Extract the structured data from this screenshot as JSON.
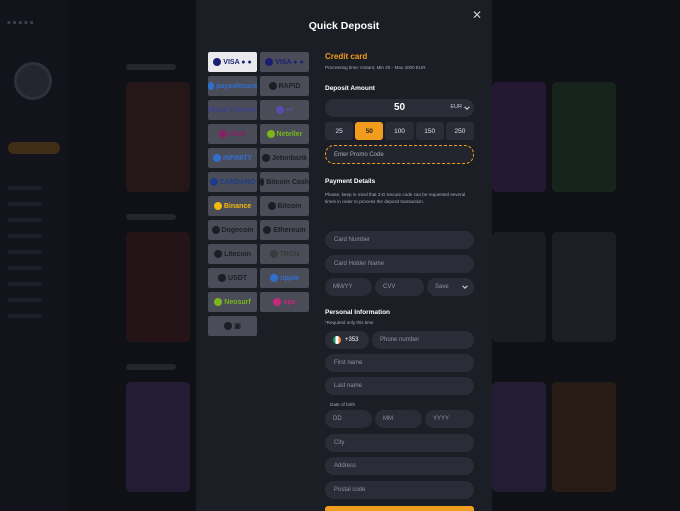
{
  "modal": {
    "title": "Quick Deposit",
    "close_icon": "close-icon"
  },
  "methods": [
    {
      "label": "VISA ● ●",
      "icon": "visa-mastercard-icon",
      "selected": true,
      "color": "#1a1f71"
    },
    {
      "label": "VISA ● ●",
      "icon": "visa-mastercard-icon",
      "selected": false,
      "color": "#1a1f71"
    },
    {
      "label": "paysafecard",
      "icon": "paysafecard-icon",
      "selected": false,
      "color": "#2f6fd0"
    },
    {
      "label": "RAPID",
      "icon": "rapid-transfer-icon",
      "selected": false,
      "color": "#1c1e26"
    },
    {
      "label": "Bank Transfer",
      "icon": "bank-transfer-icon",
      "selected": false,
      "color": "#3b3e8e"
    },
    {
      "label": "•••",
      "icon": "instant-banking-icon",
      "selected": false,
      "color": "#5a4bb0"
    },
    {
      "label": "Skrill",
      "icon": "skrill-icon",
      "selected": false,
      "color": "#862165"
    },
    {
      "label": "Neteller",
      "icon": "neteller-icon",
      "selected": false,
      "color": "#7ab51d"
    },
    {
      "label": "INFINITY",
      "icon": "infinity-icon",
      "selected": false,
      "color": "#2f6fd0"
    },
    {
      "label": "Jetonbank",
      "icon": "jetonbank-icon",
      "selected": false,
      "color": "#1c1e26"
    },
    {
      "label": "CARDANO",
      "icon": "cardano-icon",
      "selected": false,
      "color": "#1d3b8a"
    },
    {
      "label": "Bitcoin Cash",
      "icon": "bitcoin-cash-icon",
      "selected": false,
      "color": "#1c1e26"
    },
    {
      "label": "Binance",
      "icon": "binance-icon",
      "selected": false,
      "color": "#f0b90b"
    },
    {
      "label": "Bitcoin",
      "icon": "bitcoin-icon",
      "selected": false,
      "color": "#1c1e26"
    },
    {
      "label": "Dogecoin",
      "icon": "dogecoin-icon",
      "selected": false,
      "color": "#1c1e26"
    },
    {
      "label": "Ethereum",
      "icon": "ethereum-icon",
      "selected": false,
      "color": "#1c1e26"
    },
    {
      "label": "Litecoin",
      "icon": "litecoin-icon",
      "selected": false,
      "color": "#1c1e26"
    },
    {
      "label": "TRON",
      "icon": "tron-icon",
      "selected": false,
      "color": "#3a3a3a"
    },
    {
      "label": "USDT",
      "icon": "usdt-icon",
      "selected": false,
      "color": "#1c1e26"
    },
    {
      "label": "ripple",
      "icon": "ripple-icon",
      "selected": false,
      "color": "#2f6fd0"
    },
    {
      "label": "Neosurf",
      "icon": "neosurf-icon",
      "selected": false,
      "color": "#7ab51d"
    },
    {
      "label": "eps",
      "icon": "eps-icon",
      "selected": false,
      "color": "#c8287c"
    },
    {
      "label": "▣",
      "icon": "voucher-icon",
      "selected": false,
      "color": "#1c1e26"
    }
  ],
  "credit_card": {
    "title": "Credit card",
    "processing": "Processing time: Instant, Min 20 - Max 4000 EUR"
  },
  "deposit": {
    "title": "Deposit Amount",
    "amount": "50",
    "currency": "EUR",
    "chips": [
      "25",
      "50",
      "100",
      "150",
      "250"
    ],
    "active_chip": "50",
    "promo_placeholder": "Enter Promo Code"
  },
  "payment": {
    "title": "Payment Details",
    "note": "Please, keep in mind that 3-D Secure code can be requested several times in order to process the deposit transaction.",
    "card_number": "Card Number",
    "holder": "Card Holder Name",
    "mmyy": "MM/YY",
    "cvv": "CVV",
    "save": "Save"
  },
  "personal": {
    "title": "Personal Information",
    "required_note": "*Required only this time",
    "country_code": "+353",
    "phone": "Phone number",
    "first_name": "First name",
    "last_name": "Last name",
    "dob_label": "Date of birth",
    "dd": "DD",
    "mm": "MM",
    "yyyy": "YYYY",
    "city": "City",
    "address": "Address",
    "postal": "Postal code"
  },
  "colors": {
    "accent": "#f19c1c",
    "modal_bg": "#1c1e26",
    "field_bg": "#2a2d37"
  }
}
